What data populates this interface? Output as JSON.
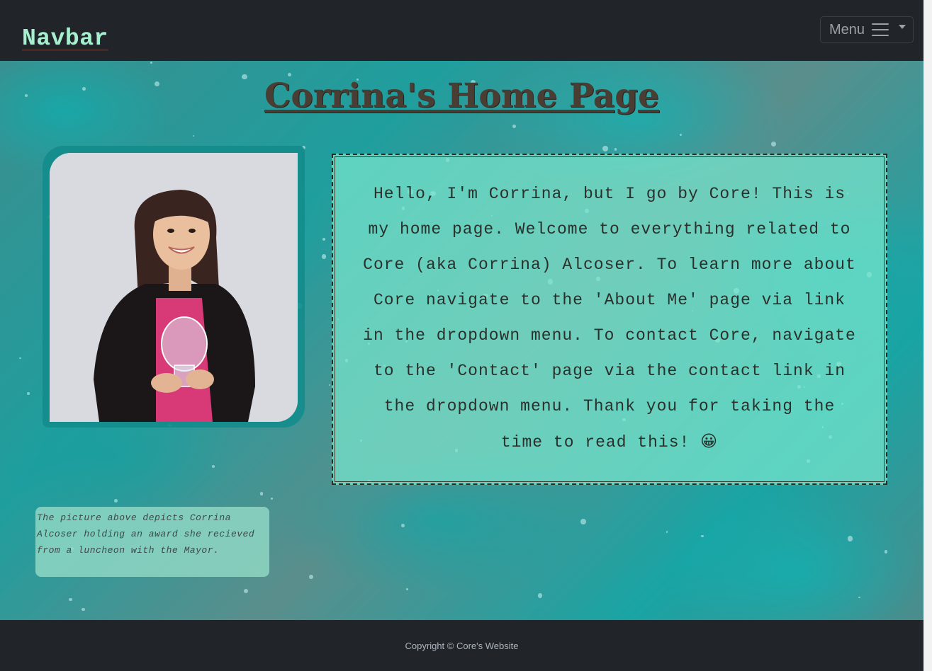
{
  "navbar": {
    "brand": "Navbar",
    "menu_label": "Menu"
  },
  "main": {
    "title": "Corrina's Home Page",
    "intro": "Hello, I'm Corrina, but I go by Core! This is my home page. Welcome to everything related to Core (aka Corrina) Alcoser. To learn more about Core navigate to the 'About Me' page via link in the dropdown menu. To contact Core, navigate to the 'Contact' page via the contact link in the dropdown menu. Thank you for taking the time to read this!",
    "intro_emoji": "😀",
    "photo_caption": "The picture above depicts Corrina Alcoser holding an award she recieved from a luncheon with the Mayor."
  },
  "footer": {
    "copyright": "Copyright © Core's Website"
  },
  "icons": {
    "menu": "hamburger-icon",
    "dropdown": "caret-down-icon"
  },
  "colors": {
    "navbar_bg": "#212529",
    "brand": "#a6f0cf",
    "title": "#4a3d33"
  }
}
